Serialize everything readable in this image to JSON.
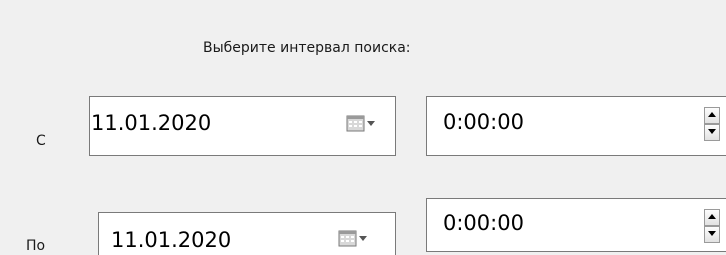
{
  "heading": "Выберите интервал поиска:",
  "rows": [
    {
      "label": "С",
      "date": "11.01.2020",
      "time": "0:00:00"
    },
    {
      "label": "По",
      "date": "11.01.2020",
      "time": "0:00:00"
    }
  ],
  "icons": {
    "calendar": "calendar-icon",
    "dropdown": "chevron-down-icon",
    "spin_up": "arrow-up-icon",
    "spin_down": "arrow-down-icon"
  }
}
